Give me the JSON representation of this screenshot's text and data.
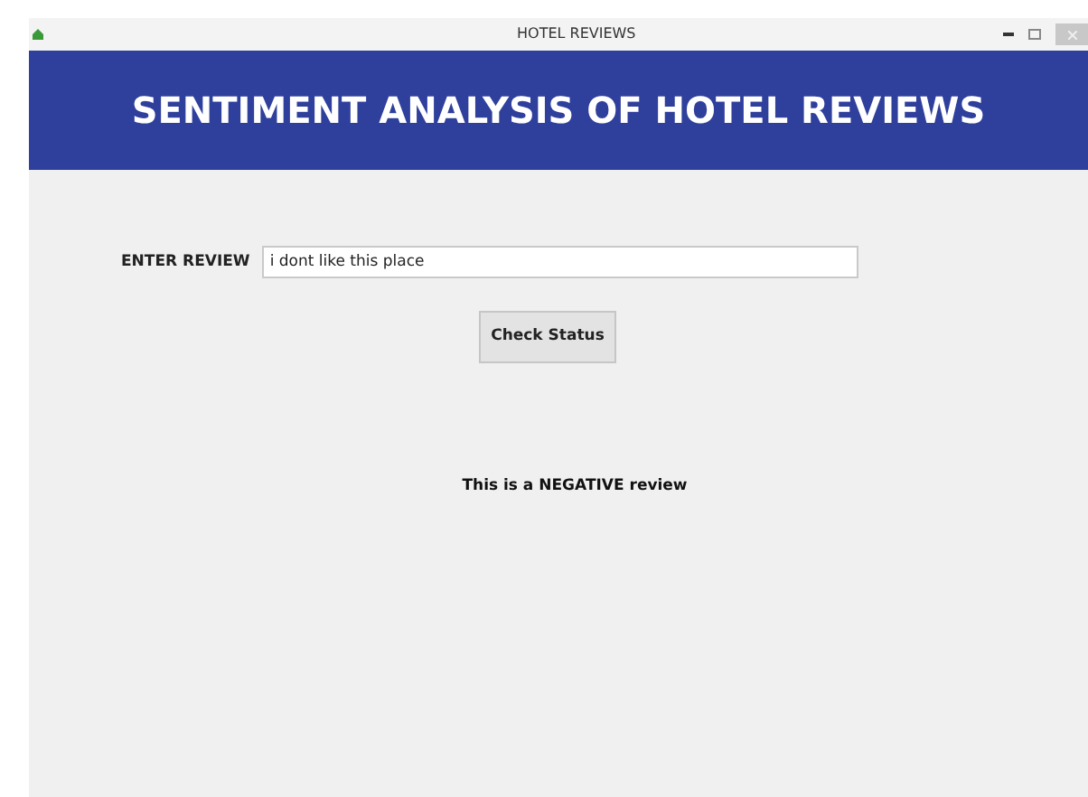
{
  "window": {
    "title": "HOTEL REVIEWS"
  },
  "banner": {
    "title": "SENTIMENT ANALYSIS OF HOTEL REVIEWS"
  },
  "review_field": {
    "label": "ENTER REVIEW",
    "value": "i dont like this place"
  },
  "check_button": {
    "label": "Check Status"
  },
  "result": {
    "text": "This is a NEGATIVE review"
  }
}
